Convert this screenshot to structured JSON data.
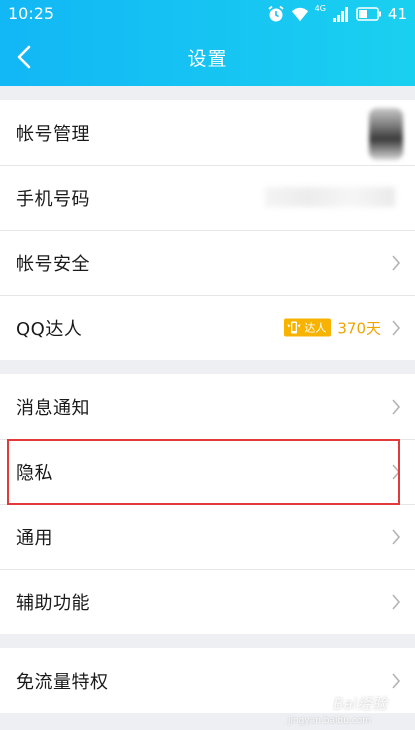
{
  "status_bar": {
    "time": "10:25",
    "network_label": "4G",
    "battery_level": "41"
  },
  "nav": {
    "title": "设置"
  },
  "groups": [
    {
      "items": [
        {
          "label": "帐号管理"
        },
        {
          "label": "手机号码"
        },
        {
          "label": "帐号安全"
        },
        {
          "label": "QQ达人",
          "badge_text": "达人",
          "days": "370天"
        }
      ]
    },
    {
      "items": [
        {
          "label": "消息通知"
        },
        {
          "label": "隐私"
        },
        {
          "label": "通用"
        },
        {
          "label": "辅助功能"
        }
      ]
    },
    {
      "items": [
        {
          "label": "免流量特权"
        }
      ]
    }
  ],
  "colors": {
    "header_gradient_start": "#12b7f5",
    "header_gradient_end": "#1ad0f0",
    "highlight_border": "#e23a3a",
    "badge": "#f7b300"
  },
  "watermark": {
    "brand": "Bai经验",
    "url": "jingyan.baidu.com"
  }
}
